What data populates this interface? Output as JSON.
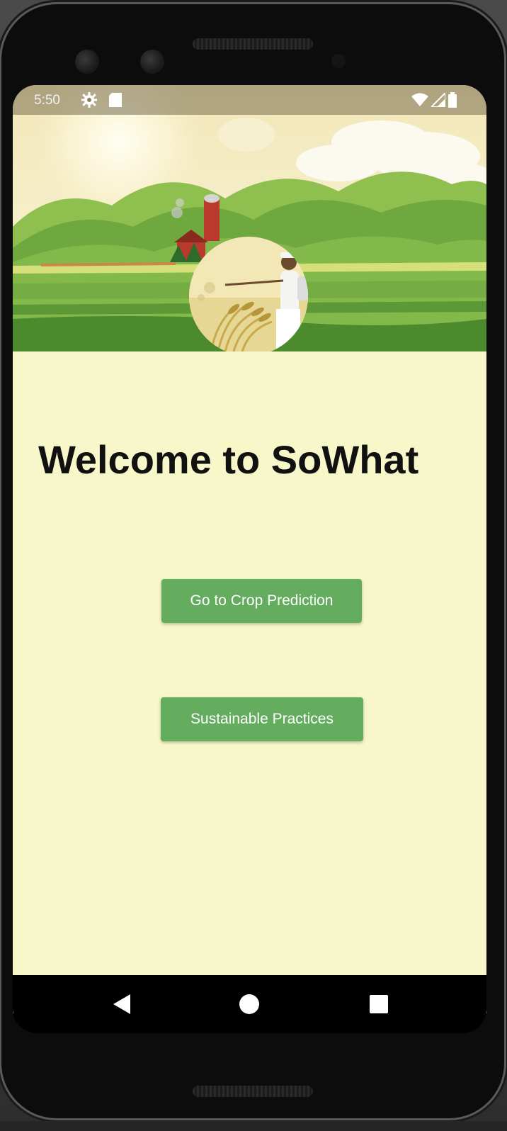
{
  "status_bar": {
    "time": "5:50",
    "icons": [
      "gear-icon",
      "sd-card-icon",
      "wifi-icon",
      "signal-icon",
      "battery-icon"
    ]
  },
  "hero": {
    "image": "farm-landscape-illustration",
    "badge_image": "farmer-spraying-crops-illustration"
  },
  "main": {
    "title": "Welcome to SoWhat",
    "buttons": {
      "crop_prediction": "Go to Crop Prediction",
      "sustainable_practices": "Sustainable Practices"
    }
  },
  "nav_bar": {
    "icons": [
      "back-icon",
      "home-icon",
      "recents-icon"
    ]
  },
  "colors": {
    "background": "#f8f7c9",
    "button": "#64ad5f",
    "button_text": "#ffffff",
    "title_text": "#111111"
  }
}
